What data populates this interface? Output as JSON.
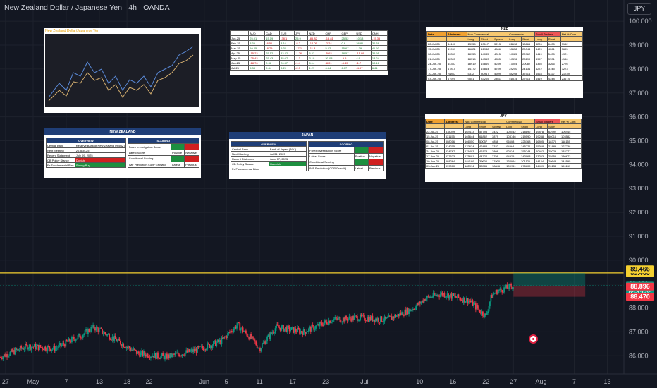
{
  "header": {
    "title": "New Zealand Dollar / Japanese Yen · 4h · OANDA",
    "currency_button": "JPY"
  },
  "chart_data": {
    "type": "candlestick",
    "title": "New Zealand Dollar / Japanese Yen · 4h · OANDA",
    "ylim": [
      85.3,
      100.3
    ],
    "y_ticks": [
      "100.000",
      "99.000",
      "98.000",
      "97.000",
      "96.000",
      "95.000",
      "94.000",
      "93.000",
      "92.000",
      "91.000",
      "90.000",
      "89.000",
      "88.000",
      "87.000",
      "86.000"
    ],
    "y_tick_values": [
      100,
      99,
      98,
      97,
      96,
      95,
      94,
      93,
      92,
      91,
      90,
      89,
      88,
      87,
      86
    ],
    "x_ticks": [
      "27",
      "May",
      "7",
      "13",
      "18",
      "22",
      "Jun",
      "5",
      "11",
      "17",
      "23",
      "Jul",
      "10",
      "16",
      "22",
      "27",
      "Aug",
      "7",
      "13"
    ],
    "x_tick_days": [
      -4,
      1,
      7,
      13,
      18,
      22,
      32,
      36,
      42,
      48,
      54,
      61,
      71,
      77,
      83,
      88,
      93,
      99,
      105
    ],
    "x_range_days": [
      -5,
      108
    ],
    "series": [
      {
        "x_days": [
          -5,
          0,
          5,
          10,
          12,
          15,
          20,
          25,
          30,
          35,
          38,
          41,
          42,
          45,
          50,
          55,
          60,
          65,
          70,
          72,
          75,
          80,
          83,
          84,
          85,
          88
        ],
        "close": [
          85.95,
          86.4,
          86.3,
          86.9,
          87.2,
          86.8,
          86.1,
          85.95,
          86.2,
          86.6,
          87.3,
          86.6,
          86.3,
          87.2,
          87.0,
          87.5,
          87.6,
          87.5,
          88.0,
          88.4,
          88.6,
          88.3,
          87.65,
          88.5,
          88.7,
          88.93
        ]
      }
    ],
    "horizontal_lines": [
      {
        "value": 89.466,
        "color": "#f5d030"
      }
    ],
    "price_labels": [
      {
        "text": "89.466",
        "value": 89.466,
        "color": "#f5d030"
      },
      {
        "text": "89.466",
        "value": 89.62,
        "color": "#f5d030"
      },
      {
        "text": "88.934",
        "value": 88.934,
        "color": "#089981",
        "countdown": "02:13:02"
      },
      {
        "text": "88.896",
        "value": 88.896,
        "color": "#f23645"
      },
      {
        "text": "88.470",
        "value": 88.47,
        "color": "#f23645"
      }
    ],
    "position_box": {
      "start_day": 88,
      "end_day": 101,
      "entry": 88.934,
      "target": 89.466,
      "stop": 88.47
    }
  },
  "overlays": {
    "line_chart_title": "New Zealand Dollar/Japanese Yen",
    "nzd_title": "NZD",
    "jpy_title": "JPY",
    "cot_headers": [
      "Date",
      "Δ Interest",
      "Non Commercial",
      "Commercial",
      "Small Traders",
      "Long",
      "Short",
      "Spread",
      "Net % Com"
    ],
    "nzd_rows": [
      [
        "22-Jul-25",
        "44100",
        "13955",
        "13117",
        "5213",
        "22698",
        "18665",
        "4226",
        "6405",
        "3162"
      ],
      [
        "15-Jul-25",
        "41959",
        "16621",
        "12988",
        "4566",
        "18658",
        "20044",
        "4429",
        "4061",
        "3695"
      ],
      [
        "08-Jul-25",
        "40357",
        "18958",
        "14085",
        "4815",
        "14025",
        "20962",
        "5419",
        "5405",
        "4921"
      ],
      [
        "01-Jul-25",
        "42305",
        "18315",
        "14363",
        "4555",
        "14376",
        "20290",
        "4957",
        "3701",
        "4150"
      ],
      [
        "24-Jun-25",
        "44357",
        "18919",
        "15869",
        "4239",
        "17004",
        "20082",
        "4355",
        "3266",
        "2776"
      ],
      [
        "17-Jun-25",
        "47815",
        "14172",
        "15844",
        "4759",
        "24250",
        "24131",
        "4272",
        "3145",
        "3273"
      ],
      [
        "10-Jun-25",
        "78867",
        "5312",
        "30947",
        "4699",
        "58298",
        "37514",
        "4563",
        "4110",
        "21239"
      ],
      [
        "03-Jun-25",
        "67925",
        "9551",
        "33205",
        "2461",
        "51514",
        "27916",
        "4419",
        "4348",
        "23674"
      ]
    ],
    "jpy_rows": [
      [
        "22-Jul-25",
        "318049",
        "164413",
        "57798",
        "3422",
        "100542",
        "218892",
        "49878",
        "62992",
        "106445"
      ],
      [
        "15-Jul-25",
        "331155",
        "165644",
        "61862",
        "3879",
        "108746",
        "219590",
        "49288",
        "66016",
        "103582"
      ],
      [
        "08-Jul-25",
        "308016",
        "166050",
        "50057",
        "4858",
        "96608",
        "225168",
        "46895",
        "18370",
        "118155"
      ],
      [
        "01-Jul-25",
        "314215",
        "170634",
        "42488",
        "3332",
        "94964",
        "245721",
        "45368",
        "21889",
        "127738"
      ],
      [
        "24-Jun-25",
        "334767",
        "179403",
        "46178",
        "3808",
        "92034",
        "255744",
        "40462",
        "25029",
        "132777"
      ],
      [
        "17-Jun-25",
        "337523",
        "175601",
        "44724",
        "3756",
        "94935",
        "243068",
        "43253",
        "25955",
        "130673"
      ],
      [
        "10-Jun-25",
        "388264",
        "184199",
        "39600",
        "17900",
        "132094",
        "301121",
        "54124",
        "29643",
        "144595"
      ],
      [
        "03-Jun-25",
        "399000",
        "185914",
        "38985",
        "18846",
        "100151",
        "275609",
        "44499",
        "20138",
        "151149"
      ]
    ],
    "nz_panel_title": "NEW ZEALAND",
    "jp_panel_title": "JAPAN",
    "panel_overview": "OVERVIEW",
    "panel_scoring": "SCORING",
    "nz_fields": [
      [
        "Central Bank",
        "Reserve Bank of New Zealand (RBNZ)"
      ],
      [
        "Next Meeting",
        "20-Aug-25"
      ],
      [
        "Recent Statement",
        "July 09, 2025"
      ],
      [
        "CB Policy Stance",
        "Dovish"
      ],
      [
        "Fx Fundamental Bias",
        "Strong Buy"
      ]
    ],
    "jp_fields": [
      [
        "Central Bank",
        "Bank of Japan (BOJ)"
      ],
      [
        "Next Meeting",
        "Jul 31, 2025"
      ],
      [
        "Recent Statement",
        "June 17, 2025"
      ],
      [
        "CB Policy Stance",
        "Hawkish"
      ],
      [
        "Fx Fundamental Bias",
        ""
      ]
    ],
    "score_rows": [
      "Forex Investigation Score",
      "Latest Score",
      "Conditional Scoring",
      "IMF Prediction (GDP Growth)"
    ],
    "score_cols": [
      "Positive",
      "Negative",
      "Latest",
      "Previous"
    ],
    "matrix_headers": [
      "",
      "AUD",
      "CAD",
      "EUR",
      "JPY",
      "NZD",
      "CHF",
      "GBP",
      "USD",
      "CNH"
    ],
    "matrix_rows": [
      [
        "Jun-25",
        "25.01",
        "15.19",
        "-38.1",
        "25.9",
        "-85.82",
        "-15.81",
        "25.52",
        "10.13",
        "-15.35",
        "-15.57"
      ],
      [
        "Feb-25",
        "8.39",
        "-6.51",
        "3.16",
        "-8.2",
        "-14.05",
        "-2.24",
        "0.8",
        "26.81",
        "36.38"
      ],
      [
        "Mar-25",
        "10.25",
        "-8.79",
        "9.32",
        "-17.1",
        "-11.3",
        "5.62",
        "15.67",
        "1.39",
        "41.93"
      ],
      [
        "Apr-25",
        "-15.23",
        "25.52",
        "43.42",
        "-1.26",
        "6.62",
        "-5.62",
        "18.57",
        "-11.99",
        "35.91"
      ],
      [
        "May-25",
        "-25.42",
        "25.43",
        "35.07",
        "-1.3",
        "3.10",
        "30.08",
        "-9.5",
        "4.9",
        "13.24"
      ],
      [
        "Jun-25",
        "-18.76",
        "0.36",
        "20.37",
        "-1.4",
        "5.14",
        "-8.01",
        "-5.45",
        "-1.7",
        "10.16"
      ],
      [
        "Jul-25",
        "5.38",
        "9.84",
        "8.29",
        "-2.3",
        "1.27",
        "6.54",
        "6.07",
        "-4.97",
        "6.61"
      ]
    ]
  }
}
